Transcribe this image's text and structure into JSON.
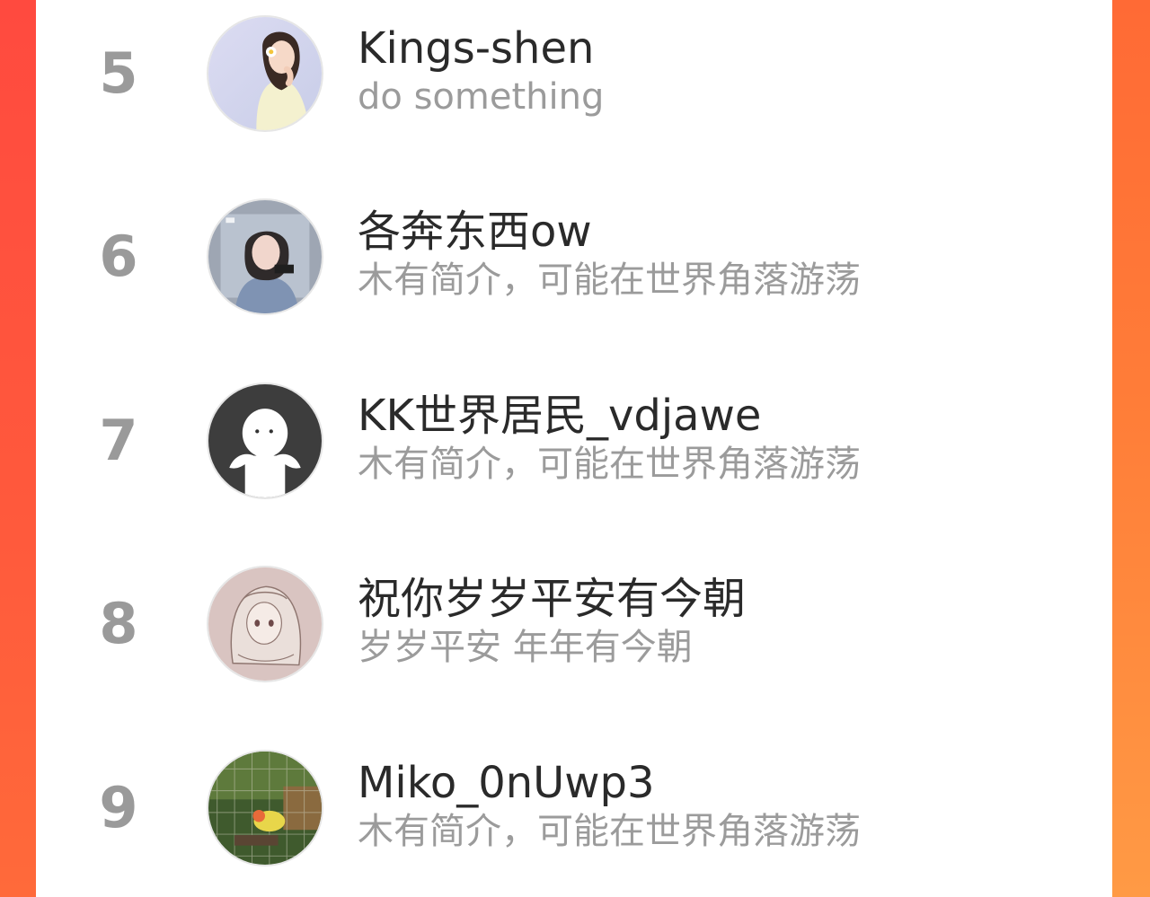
{
  "colors": {
    "background": "#ff4a3f",
    "card": "#ffffff",
    "rank": "#9a9a9a",
    "name": "#2a2a2a",
    "bio": "#9b9b9b"
  },
  "users": [
    {
      "rank": "5",
      "name": "Kings-shen",
      "bio": "do something",
      "avatar": "avatar-photo-girl-icon"
    },
    {
      "rank": "6",
      "name": "各奔东西ow",
      "bio": "木有简介，可能在世界角落游荡",
      "avatar": "avatar-photo-selfie-icon"
    },
    {
      "rank": "7",
      "name": "KK世界居民_vdjawe",
      "bio": "木有简介，可能在世界角落游荡",
      "avatar": "default-avatar-icon"
    },
    {
      "rank": "8",
      "name": "祝你岁岁平安有今朝",
      "bio": "岁岁平安 年年有今朝",
      "avatar": "avatar-illustration-icon"
    },
    {
      "rank": "9",
      "name": "Miko_0nUwp3",
      "bio": "木有简介，可能在世界角落游荡",
      "avatar": "avatar-photo-bird-icon"
    }
  ]
}
